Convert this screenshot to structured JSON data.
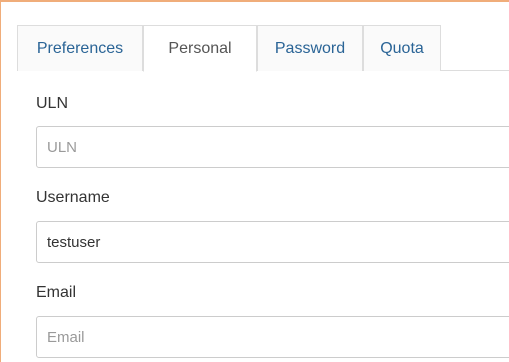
{
  "tabs": [
    {
      "label": "Preferences",
      "active": false
    },
    {
      "label": "Personal",
      "active": true
    },
    {
      "label": "Password",
      "active": false
    },
    {
      "label": "Quota",
      "active": false
    }
  ],
  "form": {
    "uln": {
      "label": "ULN",
      "value": "",
      "placeholder": "ULN"
    },
    "username": {
      "label": "Username",
      "value": "testuser",
      "placeholder": ""
    },
    "email": {
      "label": "Email",
      "value": "",
      "placeholder": "Email"
    }
  },
  "colors": {
    "accent_border": "#f0ad7a",
    "tab_link": "#2a6496"
  }
}
